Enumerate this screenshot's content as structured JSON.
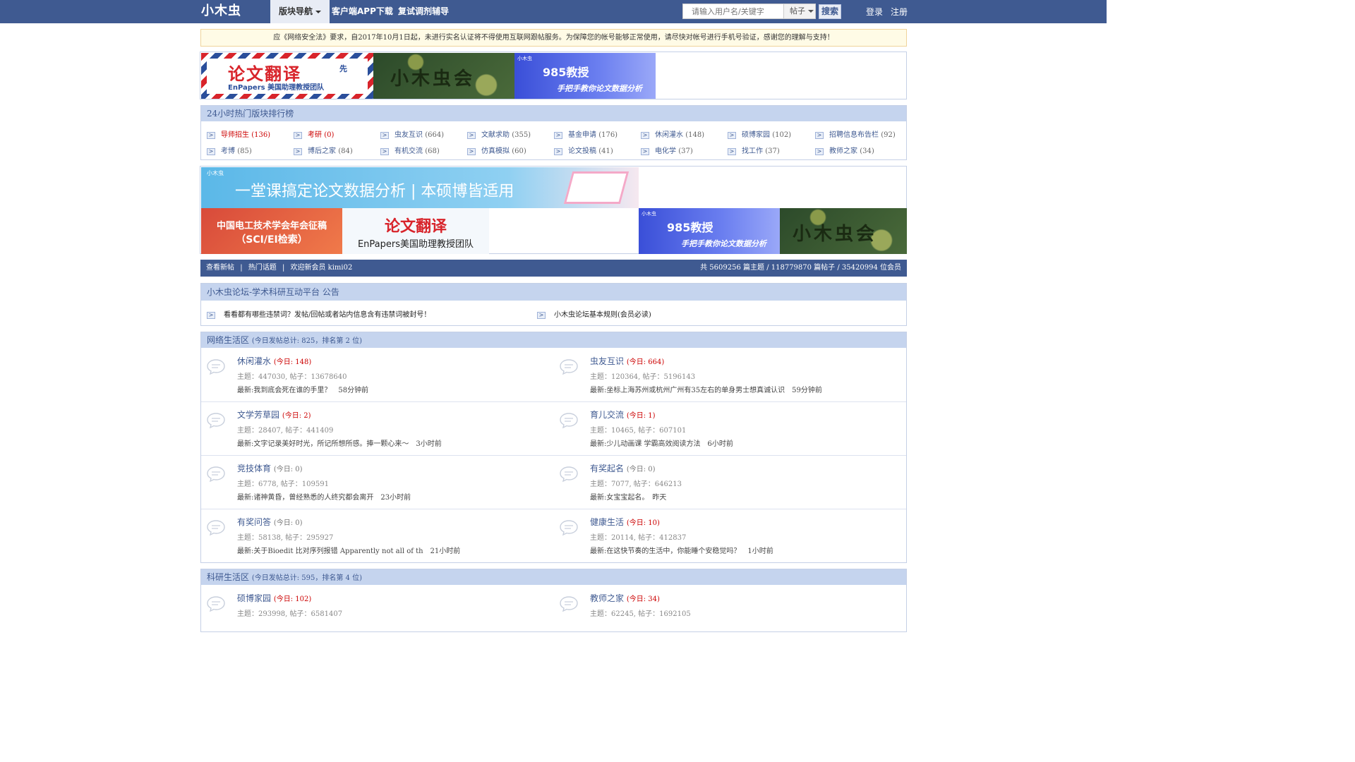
{
  "header": {
    "logo": "小木虫",
    "nav": [
      "版块导航",
      "客户端APP下载",
      "复试调剂辅导"
    ],
    "search_placeholder": "请输入用户名/关键字",
    "search_type": "帖子",
    "search_button": "搜索",
    "login": "登录",
    "register": "注册",
    "accent": "#3f5a91"
  },
  "notice": "应《网络安全法》要求，自2017年10月1日起，未进行实名认证将不得使用互联网跟帖服务。为保障您的帐号能够正常使用，请尽快对帐号进行手机号验证，感谢您的理解与支持！",
  "ads": {
    "a1_title": "论文翻译",
    "a1_sub": "EnPapers 美国助理教授团队",
    "a1_tag": "先",
    "a2_text": "小木虫会",
    "a3_logo": "小木虫",
    "a3_title": "985教授",
    "a3_sub": "手把手教你论文数据分析",
    "a4_logo": "小木虫",
    "a4_text": "一堂课搞定论文数据分析 | 本硕博皆适用",
    "a5_title": "中国电工技术学会年会征稿",
    "a5_sub": "（SCI/EI检索）",
    "a6_title": "论文翻译",
    "a6_sub": "EnPapers美国助理教授团队",
    "a7_logo": "小木虫",
    "a7_title": "985教授",
    "a7_sub": "手把手教你论文数据分析",
    "a8_text": "小木虫会"
  },
  "ranking": {
    "title": "24小时热门版块排行榜",
    "items": [
      {
        "name": "导师招生",
        "count": "(136)"
      },
      {
        "name": "考研",
        "count": "(0)"
      },
      {
        "name": "虫友互识",
        "count": "(664)"
      },
      {
        "name": "文献求助",
        "count": "(355)"
      },
      {
        "name": "基金申请",
        "count": "(176)"
      },
      {
        "name": "休闲灌水",
        "count": "(148)"
      },
      {
        "name": "硕博家园",
        "count": "(102)"
      },
      {
        "name": "招聘信息布告栏",
        "count": "(92)"
      },
      {
        "name": "考博",
        "count": "(85)"
      },
      {
        "name": "博后之家",
        "count": "(84)"
      },
      {
        "name": "有机交流",
        "count": "(68)"
      },
      {
        "name": "仿真模拟",
        "count": "(60)"
      },
      {
        "name": "论文投稿",
        "count": "(41)"
      },
      {
        "name": "电化学",
        "count": "(37)"
      },
      {
        "name": "找工作",
        "count": "(37)"
      },
      {
        "name": "教师之家",
        "count": "(34)"
      }
    ]
  },
  "stats": {
    "links": [
      "查看新帖",
      "热门话题",
      "欢迎新会员 kimi02"
    ],
    "summary": "共 5609256 篇主题 / 118779870 篇帖子 / 35420994 位会员"
  },
  "announce": {
    "title": "小木虫论坛-学术科研互动平台 公告",
    "items": [
      "看看都有哪些违禁词？发帖/回帖或者站内信息含有违禁词被封号！",
      "小木虫论坛基本规则(会员必读)"
    ]
  },
  "zone1": {
    "title": "网络生活区",
    "info": "(今日发帖总计: 825，排名第 2 位)",
    "forums": [
      {
        "name": "休闲灌水",
        "today": "(今日: 148)",
        "meta": "主题：447030, 帖子：13678640",
        "latest": "最新:我到底会死在谁的手里？　58分钟前"
      },
      {
        "name": "虫友互识",
        "today": "(今日: 664)",
        "meta": "主题：120364, 帖子：5196143",
        "latest": "最新:坐标上海苏州或杭州广州有35左右的单身男士想真诚认识　59分钟前"
      },
      {
        "name": "文学芳草园",
        "today": "(今日: 2)",
        "meta": "主题：28407, 帖子：441409",
        "latest": "最新:文字记录美好时光，所记所想所感。捧一颗心来～　3小时前"
      },
      {
        "name": "育儿交流",
        "today": "(今日: 1)",
        "meta": "主题：10465, 帖子：607101",
        "latest": "最新:少儿动画课 学霸高效阅读方法　6小时前"
      },
      {
        "name": "竞技体育",
        "today": "(今日: 0)",
        "meta": "主题：6778, 帖子：109591",
        "latest": "最新:诸神黄昏，曾经熟悉的人终究都会离开　23小时前"
      },
      {
        "name": "有奖起名",
        "today": "(今日: 0)",
        "meta": "主题：7077, 帖子：646213",
        "latest": "最新:女宝宝起名。　昨天"
      },
      {
        "name": "有奖问答",
        "today": "(今日: 0)",
        "meta": "主题：58138, 帖子：295927",
        "latest": "最新:关于Bioedit 比对序列报错 Apparently not all of th　21小时前"
      },
      {
        "name": "健康生活",
        "today": "(今日: 10)",
        "meta": "主题：20114, 帖子：412837",
        "latest": "最新:在这快节奏的生活中，你能睡个安稳觉吗？　1小时前"
      }
    ]
  },
  "zone2": {
    "title": "科研生活区",
    "info": "(今日发帖总计: 595，排名第 4 位)",
    "forums": [
      {
        "name": "硕博家园",
        "today": "(今日: 102)",
        "meta": "主题：293998, 帖子：6581407"
      },
      {
        "name": "教师之家",
        "today": "(今日: 34)",
        "meta": "主题：62245, 帖子：1692105"
      }
    ]
  }
}
